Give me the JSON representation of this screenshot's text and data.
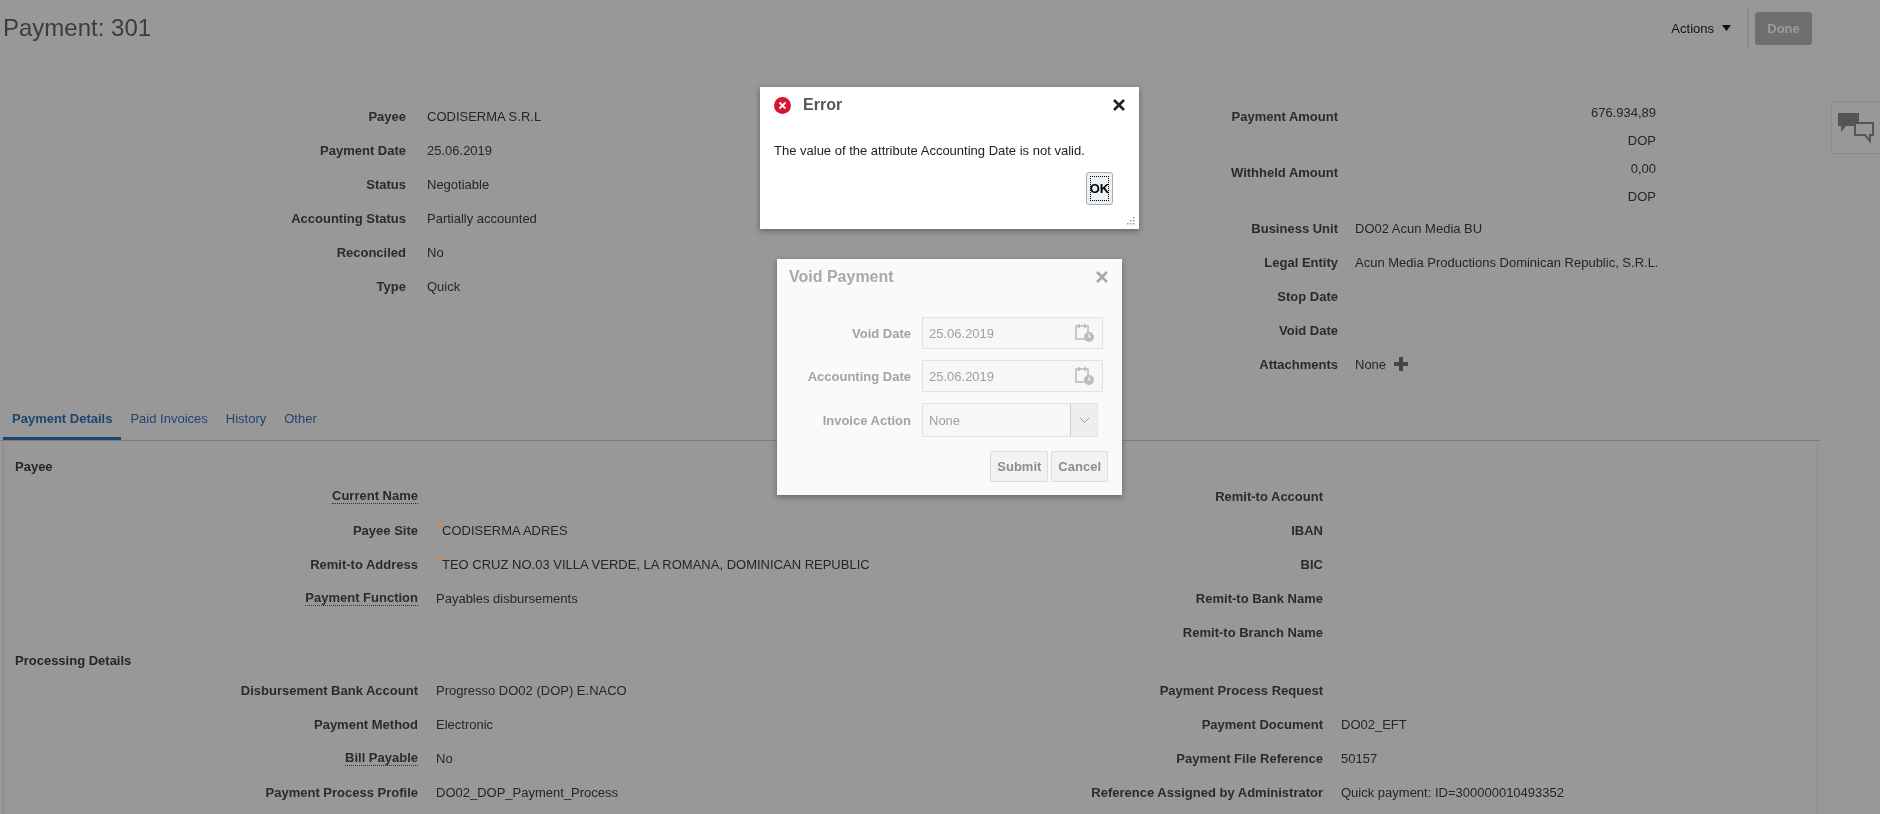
{
  "page": {
    "title": "Payment: 301",
    "actions": "Actions",
    "done": "Done"
  },
  "summary_left": [
    {
      "label": "Payee",
      "value": "CODISERMA S.R.L"
    },
    {
      "label": "Payment Date",
      "value": "25.06.2019"
    },
    {
      "label": "Status",
      "value": "Negotiable"
    },
    {
      "label": "Accounting Status",
      "value": "Partially accounted"
    },
    {
      "label": "Reconciled",
      "value": "No"
    },
    {
      "label": "Type",
      "value": "Quick"
    }
  ],
  "summary_right": [
    {
      "kind": "amount",
      "label": "Payment Amount",
      "value": "676.934,89",
      "currency": "DOP"
    },
    {
      "kind": "amount",
      "label": "Withheld Amount",
      "value": "0,00",
      "currency": "DOP"
    },
    {
      "kind": "text",
      "label": "Business Unit",
      "value": "DO02 Acun Media BU"
    },
    {
      "kind": "text",
      "label": "Legal Entity",
      "value": "Acun Media Productions Dominican Republic, S.R.L."
    },
    {
      "kind": "text",
      "label": "Stop Date"
    },
    {
      "kind": "text",
      "label": "Void Date"
    },
    {
      "kind": "attachment",
      "label": "Attachments",
      "value": "None"
    }
  ],
  "tabs": [
    {
      "label": "Payment Details",
      "selected": true
    },
    {
      "label": "Paid Invoices",
      "selected": false
    },
    {
      "label": "History",
      "selected": false
    },
    {
      "label": "Other",
      "selected": false
    }
  ],
  "sections": [
    {
      "heading": "Payee",
      "left": [
        {
          "label": "Current Name",
          "underlined": true
        },
        {
          "label": "Payee Site",
          "value": "CODISERMA ADRES",
          "underlined": false,
          "flagged": true
        },
        {
          "label": "Remit-to Address",
          "value": "TEO CRUZ NO.03 VILLA VERDE, LA ROMANA, DOMINICAN REPUBLIC",
          "underlined": false,
          "flagged": true
        },
        {
          "label": "Payment Function",
          "value": "Payables disbursements",
          "underlined": true,
          "flagged": false
        }
      ],
      "right": [
        {
          "label": "Remit-to Account",
          "underlined": false
        },
        {
          "label": "IBAN",
          "underlined": false
        },
        {
          "label": "BIC",
          "underlined": false
        },
        {
          "label": "Remit-to Bank Name",
          "underlined": false
        },
        {
          "label": "Remit-to Branch Name",
          "underlined": false
        }
      ]
    },
    {
      "heading": "Processing Details",
      "left": [
        {
          "label": "Disbursement Bank Account",
          "value": "Progresso DO02 (DOP) E.NACO",
          "underlined": false,
          "flagged": false
        },
        {
          "label": "Payment Method",
          "value": "Electronic",
          "underlined": false,
          "flagged": false
        },
        {
          "label": "Bill Payable",
          "value": "No",
          "underlined": true,
          "flagged": false
        },
        {
          "label": "Payment Process Profile",
          "value": "DO02_DOP_Payment_Process",
          "underlined": false,
          "flagged": false
        }
      ],
      "right": [
        {
          "label": "Payment Process Request",
          "underlined": false
        },
        {
          "label": "Payment Document",
          "value": "DO02_EFT",
          "underlined": false,
          "flagged": false
        },
        {
          "label": "Payment File Reference",
          "value": "50157",
          "underlined": false,
          "flagged": false
        },
        {
          "label": "Reference Assigned by Administrator",
          "value": "Quick payment: ID=300000010493352",
          "underlined": false,
          "flagged": false
        }
      ]
    }
  ],
  "error_dialog": {
    "title": "Error",
    "message": "The value of the attribute Accounting Date is not valid.",
    "button": "OK"
  },
  "void_dialog": {
    "title": "Void Payment",
    "fields": [
      {
        "kind": "date",
        "label": "Void Date",
        "value": "25.06.2019"
      },
      {
        "kind": "date",
        "label": "Accounting Date",
        "value": "25.06.2019"
      },
      {
        "kind": "select",
        "label": "Invoice Action",
        "value": "None"
      }
    ],
    "buttons": [
      "Submit",
      "Cancel"
    ]
  }
}
